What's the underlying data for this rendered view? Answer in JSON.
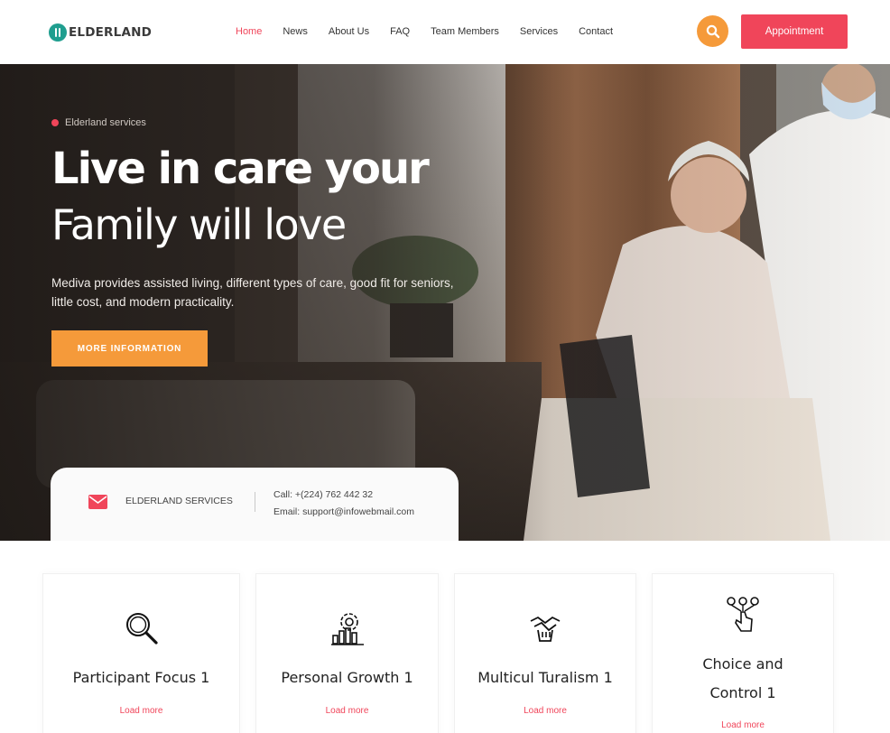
{
  "colors": {
    "accent": "#f0455a",
    "orange": "#f59a3a",
    "teal": "#1f9e8f"
  },
  "header": {
    "logo_text": "ELDERLAND",
    "nav": [
      {
        "label": "Home",
        "active": true
      },
      {
        "label": "News"
      },
      {
        "label": "About Us"
      },
      {
        "label": "FAQ"
      },
      {
        "label": "Team Members"
      },
      {
        "label": "Services"
      },
      {
        "label": "Contact"
      }
    ],
    "search_icon": "search-icon",
    "appointment_label": "Appointment"
  },
  "hero": {
    "eyebrow": "Elderland services",
    "title_line1": "Live in care your",
    "title_line2": "Family will love",
    "description": "Mediva provides assisted living, different types of care, good fit for seniors, little cost, and modern practicality.",
    "button_label": "MORE INFORMATION",
    "image": "photo: nurse pushing smiling elderly woman in wheelchair"
  },
  "contact_card": {
    "icon": "mail-icon",
    "label": "ELDERLAND SERVICES",
    "phone": "Call: +(224) 762 442 32",
    "email": "Email: support@infowebmail.com"
  },
  "features": [
    {
      "icon": "magnifier-icon",
      "title": "Participant Focus 1",
      "link": "Load more"
    },
    {
      "icon": "growth-chart-icon",
      "title": "Personal Growth 1",
      "link": "Load more"
    },
    {
      "icon": "handshake-icon",
      "title": "Multicul Turalism 1",
      "link": "Load more"
    },
    {
      "icon": "choice-hand-icon",
      "title_line1": "Choice and",
      "title_line2": "Control 1",
      "link": "Load more"
    }
  ]
}
